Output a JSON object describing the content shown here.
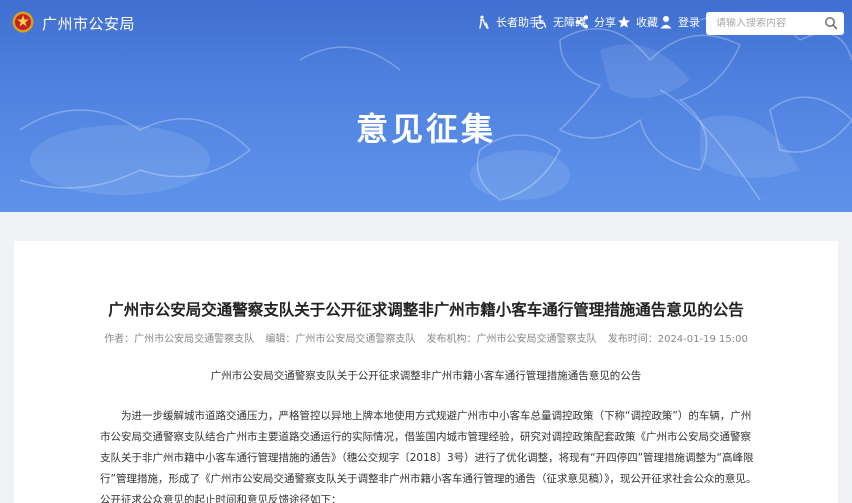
{
  "header": {
    "site_title": "广州市公安局",
    "toolbar": {
      "elder_label": "长者助手",
      "accessibility_label": "无障碍",
      "share_label": "分享",
      "favorite_label": "收藏",
      "login_label": "登录"
    },
    "search": {
      "placeholder": "请输入搜索内容"
    }
  },
  "banner": {
    "heading": "意见征集"
  },
  "article": {
    "title": "广州市公安局交通警察支队关于公开征求调整非广州市籍小客车通行管理措施通告意见的公告",
    "meta": {
      "author": "作者：广州市公安局交通警察支队",
      "editor": "编辑：广州市公安局交通警察支队",
      "publisher": "发布机构：广州市公安局交通警察支队",
      "publish_time": "发布时间：2024-01-19 15:00"
    },
    "subtitle": "广州市公安局交通警察支队关于公开征求调整非广州市籍小客车通行管理措施通告意见的公告",
    "paragraph": "为进一步缓解城市道路交通压力，严格管控以异地上牌本地使用方式规避广州市中小客车总量调控政策（下称“调控政策”）的车辆，广州市公安局交通警察支队结合广州市主要道路交通运行的实际情况，借鉴国内城市管理经验，研究对调控政策配套政策《广州市公安局交通警察支队关于非广州市籍中小客车通行管理措施的通告》（穗公交规字〔2018〕3号）进行了优化调整，将现有“开四停四”管理措施调整为“高峰限行”管理措施，形成了《广州市公安局交通警察支队关于调整非广州市籍小客车通行管理的通告（征求意见稿）》，现公开征求社会公众的意见。公开征求公众意见的起止时间和意见反馈途径如下："
  },
  "colors": {
    "banner": "#4f82e0",
    "text": "#333333",
    "meta": "#888888"
  }
}
